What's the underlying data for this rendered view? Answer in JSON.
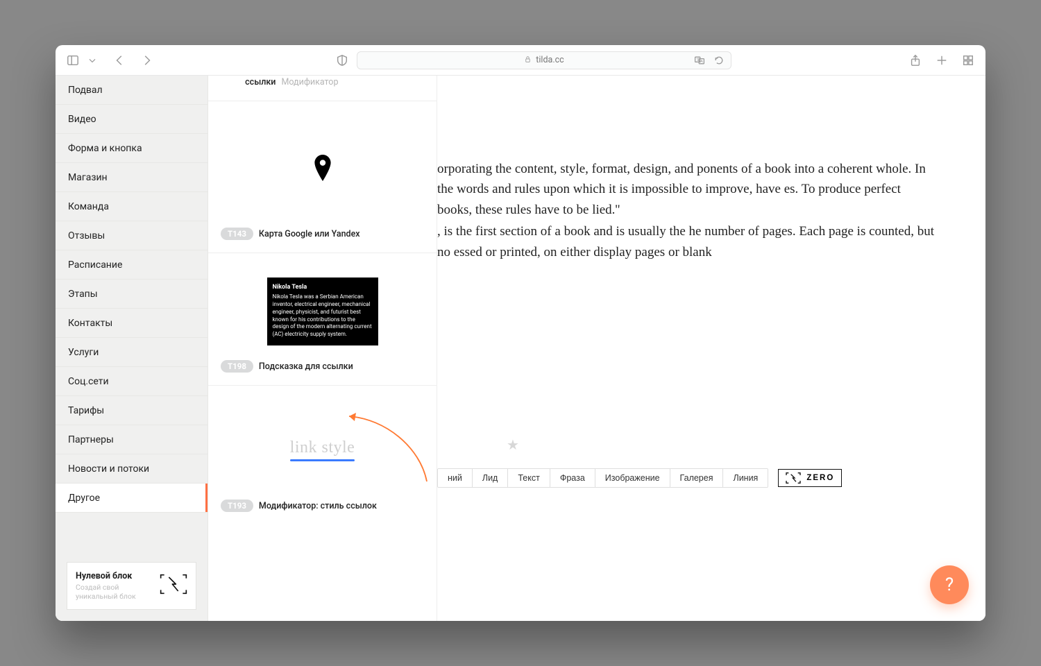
{
  "browser": {
    "url_display": "tilda.cc"
  },
  "sidebar": {
    "categories": [
      "Подвал",
      "Видео",
      "Форма и кнопка",
      "Магазин",
      "Команда",
      "Отзывы",
      "Расписание",
      "Этапы",
      "Контакты",
      "Услуги",
      "Соц.сети",
      "Тарифы",
      "Партнеры",
      "Новости и потоки",
      "Другое"
    ],
    "active_index": 14,
    "zero_block": {
      "title": "Нулевой блок",
      "subtitle": "Создай свой уникальный блок"
    }
  },
  "blocks": {
    "cutoff": {
      "code": "",
      "title_line1": "",
      "title_line2": "ссылки",
      "modifier": "Модификатор"
    },
    "map": {
      "code": "T143",
      "title": "Карта Google или Yandex"
    },
    "tooltip": {
      "code": "T198",
      "title": "Подсказка для ссылки",
      "preview_title": "Nikola Tesla",
      "preview_body": "Nikola Tesla was a Serbian American inventor, electrical engineer, mechanical engineer, physicist, and futurist best known for his contributions to the design of the modern alternating current (AC) electricity supply system."
    },
    "linkstyle": {
      "code": "T193",
      "title": "Модификатор: стиль ссылок",
      "preview_text": "link style"
    }
  },
  "canvas": {
    "paragraph1": "orporating the content, style, format, design, and ponents of a book into a coherent whole. In the words and rules upon which it is impossible to improve, have es. To produce perfect books, these rules have to be lied.''",
    "paragraph2": ", is the first section of a book and is usually the he number of pages. Each page is counted, but no essed or printed, on either display pages or blank"
  },
  "shortcut_buttons": [
    "ний",
    "Лид",
    "Текст",
    "Фраза",
    "Изображение",
    "Галерея",
    "Линия"
  ],
  "zero_button_label": "ZERO",
  "help_label": "?"
}
